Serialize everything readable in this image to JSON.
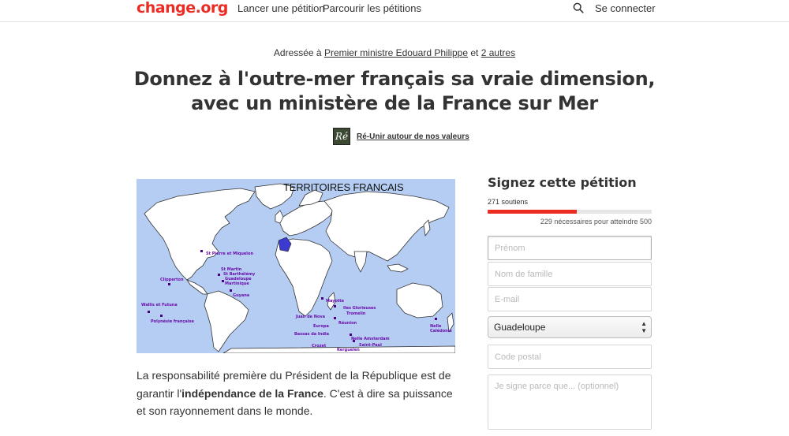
{
  "header": {
    "logo": "change.org",
    "nav": [
      "Lancer une pétition",
      "Parcourir les pétitions"
    ],
    "login": "Se connecter"
  },
  "petition": {
    "addressed_prefix": "Adressée à",
    "addressed_to": "Premier ministre Edouard Philippe",
    "addressed_and": "et",
    "addressed_others": "2 autres",
    "title_line1": "Donnez à l'outre-mer français sa vraie dimension,",
    "title_line2": "avec un ministère de la France sur Mer",
    "author_initials": "Ré",
    "author_name": "Ré-Unir autour de nos valeurs"
  },
  "map": {
    "title": "TERRITOIRES FRANCAIS",
    "labels": [
      "St Pierre et Miquelon",
      "St Martin",
      "St Barthélémy",
      "Guadeloupe",
      "Martinique",
      "Clipperton",
      "Guyane",
      "Wallis et Futuna",
      "Polynésie française",
      "Mayotte",
      "Iles Glorieuses",
      "Tromelin",
      "Juan de Nova",
      "Europa",
      "Réunion",
      "Bassas da India",
      "Nelle Amsterdam",
      "Crozet",
      "Kerguelen",
      "Saint-Paul",
      "Nelle Calédonie"
    ]
  },
  "body": {
    "p1_a": "La responsabilité première du Président de la République est de garantir l'",
    "p1_bold": "indépendance de la France",
    "p1_b": ". C'est à dire sa puissance et son rayonnement dans le monde."
  },
  "sign": {
    "title": "Signez cette pétition",
    "supporters": "271 soutiens",
    "progress_fraction": 0.542,
    "needed": "229 nécessaires pour atteindre 500",
    "first_name_placeholder": "Prénom",
    "last_name_placeholder": "Nom de famille",
    "email_placeholder": "E-mail",
    "country": "Guadeloupe",
    "postal_placeholder": "Code postal",
    "reason_placeholder": "Je signe parce que... (optionnel)"
  },
  "colors": {
    "brand": "#ec2c22",
    "map_ocean": "#b5cdf2",
    "map_label": "#6a0dad"
  }
}
